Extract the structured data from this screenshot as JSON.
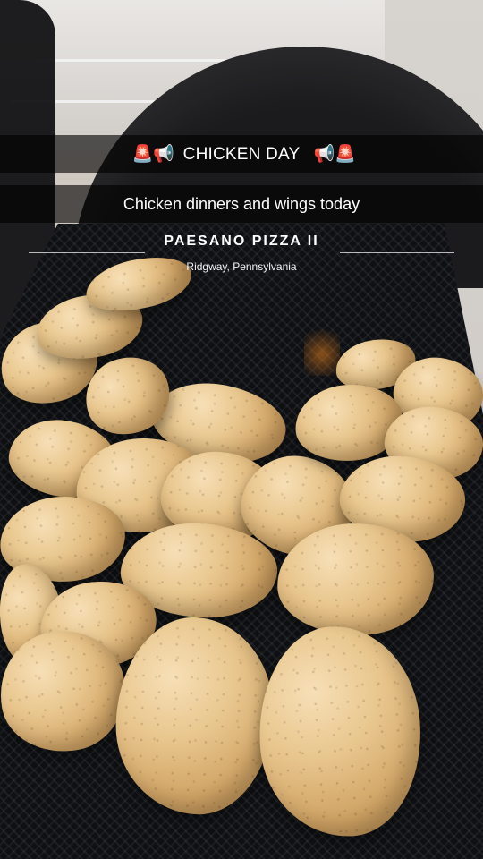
{
  "story": {
    "title": "CHICKEN DAY",
    "subtitle": "Chicken dinners and wings today"
  },
  "geofilter": {
    "name": "PAESANO PIZZA  II",
    "location": "Ridgway, Pennsylvania"
  },
  "icons": {
    "left": [
      "siren-icon",
      "megaphone-icon"
    ],
    "right": [
      "megaphone-icon",
      "siren-icon"
    ]
  },
  "colors": {
    "overlay": "#000000",
    "text": "#ffffff",
    "siren": "#ff3b30"
  }
}
